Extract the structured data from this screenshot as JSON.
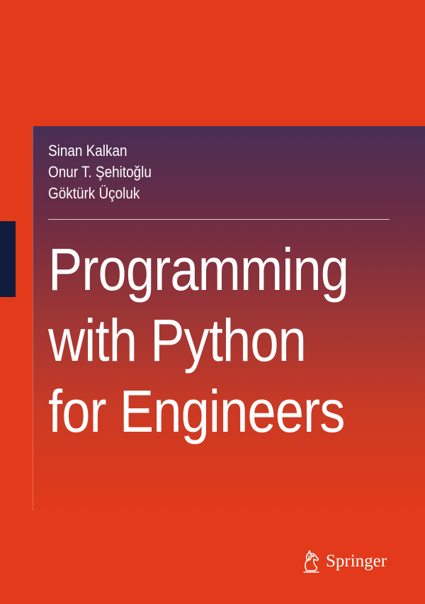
{
  "book": {
    "authors": [
      "Sinan Kalkan",
      "Onur T. Şehitoğlu",
      "Göktürk Üçoluk"
    ],
    "title_lines": [
      "Programming",
      "with Python",
      "for Engineers"
    ],
    "publisher": "Springer",
    "publisher_logo_icon": "springer-horse-icon"
  },
  "colors": {
    "cover_background": "#e23a1a",
    "panel_top": "#482f55",
    "spine_tab": "#101d3c",
    "text": "#ffffff"
  }
}
